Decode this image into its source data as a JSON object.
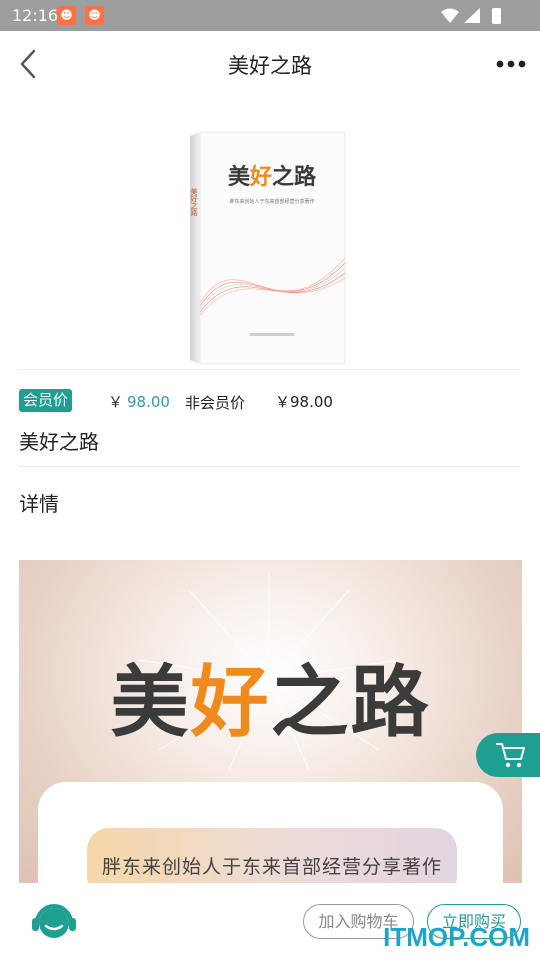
{
  "status_bar": {
    "time": "12:16",
    "notifications": [
      "game-notification-icon",
      "game-notification-icon"
    ],
    "icons": [
      "wifi-icon",
      "signal-icon",
      "battery-charging-icon"
    ]
  },
  "header": {
    "title": "美好之路"
  },
  "product": {
    "cover": {
      "title": "美好之路",
      "subtitle": "胖东来创始人于东来首部经营分享著作"
    },
    "member_badge": "会员价",
    "member_price_symbol": "￥",
    "member_price": "98.00",
    "nonmember_label": "非会员价",
    "nonmember_price": "￥98.00",
    "name": "美好之路"
  },
  "details": {
    "label": "详情",
    "banner": {
      "title_part1": "美",
      "title_accent1": "好",
      "title_part2": "之",
      "title_part3": "路",
      "subtitle": "胖东来创始人于东来首部经营分享著作"
    }
  },
  "bottom_bar": {
    "add_to_cart": "加入购物车",
    "buy_now": "立即购买"
  },
  "watermark": "ITMOP.COM",
  "colors": {
    "accent": "#1f9e92",
    "price_blue": "#2a9cc0",
    "banner_orange": "#f08a1c",
    "status_bar": "#9e9e9e"
  }
}
